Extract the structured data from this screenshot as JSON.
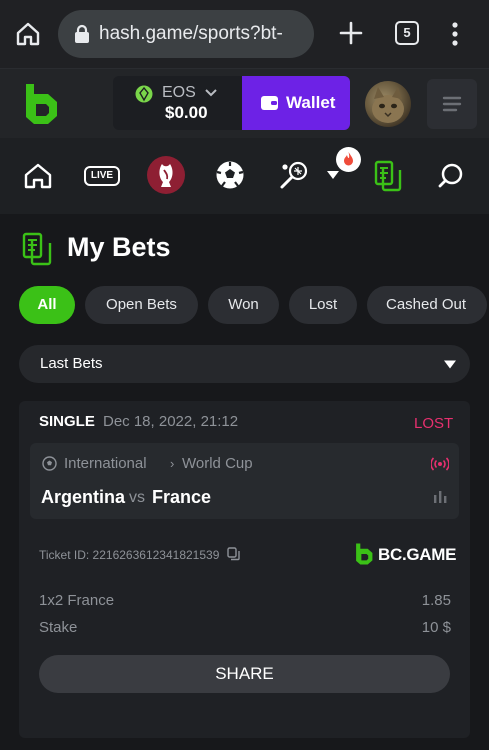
{
  "browser": {
    "url": "hash.game/sports?bt-",
    "tab_count": "5"
  },
  "header": {
    "currency": "EOS",
    "balance": "$0.00",
    "wallet_label": "Wallet"
  },
  "sports_nav": {
    "live_label": "LIVE",
    "items": [
      "home-icon",
      "live-badge",
      "world-cup-icon",
      "soccer-ball-icon",
      "tennis-icon",
      "dropdown-caret-icon",
      "fire-icon",
      "my-bets-icon",
      "search-icon"
    ]
  },
  "page": {
    "title": "My Bets"
  },
  "filters": {
    "tabs": [
      {
        "label": "All",
        "active": true
      },
      {
        "label": "Open Bets",
        "active": false
      },
      {
        "label": "Won",
        "active": false
      },
      {
        "label": "Lost",
        "active": false
      },
      {
        "label": "Cashed Out",
        "active": false
      }
    ]
  },
  "dropdown": {
    "selected": "Last Bets"
  },
  "bet": {
    "type": "SINGLE",
    "date": "Dec 18, 2022, 21:12",
    "status": "LOST",
    "league_parent": "International",
    "league": "World Cup",
    "team_home": "Argentina",
    "vs": "vs",
    "team_away": "France",
    "ticket_id": "Ticket ID: 2216263612341821539",
    "brand": "BC.GAME",
    "selection": "1x2 France",
    "odds": "1.85",
    "stake_label": "Stake",
    "stake": "10 $",
    "share_label": "SHARE"
  },
  "colors": {
    "accent_green": "#3bc117",
    "wallet_purple": "#6d22e6",
    "lost_red": "#e7306f",
    "background": "#17181b"
  }
}
